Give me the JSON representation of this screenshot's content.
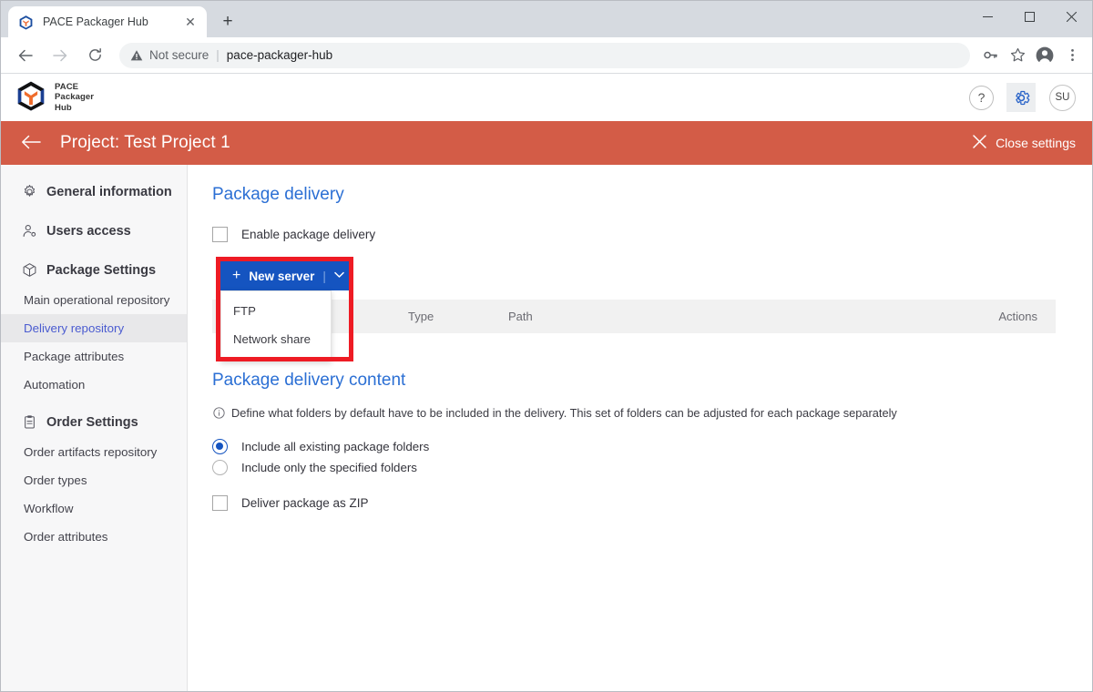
{
  "browser": {
    "tab": {
      "title": "PACE Packager Hub",
      "favicon_icon": "pace-cube-icon",
      "close_icon": "✕"
    },
    "new_tab_label": "+",
    "window_controls": {
      "minimize": "–",
      "maximize": "☐",
      "close": "✕"
    },
    "nav": {
      "back_icon": "←",
      "forward_icon": "→",
      "reload_icon": "⟳"
    },
    "omnibox": {
      "security_label": "Not secure",
      "divider": "|",
      "url": "pace-packager-hub",
      "warning_icon": "warning-triangle-icon"
    },
    "toolbar_icons": [
      "key-icon",
      "star-icon",
      "profile-avatar-icon",
      "kebab-menu-icon"
    ]
  },
  "app": {
    "brand": {
      "line1": "PACE",
      "line2": "Packager",
      "line3": "Hub",
      "logo_icon": "pace-cube-logo"
    },
    "help_label": "?",
    "settings_icon": "gear-icon",
    "avatar_initials": "SU",
    "project_bar": {
      "back_icon": "←",
      "title": "Project: Test Project 1",
      "close_icon": "✕",
      "close_label": "Close settings",
      "color": "#d35c47"
    }
  },
  "sidebar": {
    "groups": [
      {
        "label": "General information",
        "icon": "gear-icon",
        "items": []
      },
      {
        "label": "Users access",
        "icon": "user-access-icon",
        "items": []
      },
      {
        "label": "Package Settings",
        "icon": "package-cube-icon",
        "items": [
          {
            "label": "Main operational repository",
            "active": false
          },
          {
            "label": "Delivery repository",
            "active": true
          },
          {
            "label": "Package attributes",
            "active": false
          },
          {
            "label": "Automation",
            "active": false
          }
        ]
      },
      {
        "label": "Order Settings",
        "icon": "clipboard-icon",
        "items": [
          {
            "label": "Order artifacts repository",
            "active": false
          },
          {
            "label": "Order types",
            "active": false
          },
          {
            "label": "Workflow",
            "active": false
          },
          {
            "label": "Order attributes",
            "active": false
          }
        ]
      }
    ],
    "active_color": "#4a5bd0"
  },
  "content": {
    "package_delivery": {
      "title": "Package delivery",
      "enable_checkbox": {
        "label": "Enable package delivery",
        "checked": false
      },
      "new_server_button": {
        "plus": "+",
        "label": "New server",
        "divider": "|",
        "caret": "⌄",
        "color": "#1554c0"
      },
      "dropdown": {
        "open": true,
        "items": [
          {
            "label": "FTP"
          },
          {
            "label": "Network share"
          }
        ]
      },
      "table_headers": {
        "name": "",
        "type": "Type",
        "path": "Path",
        "actions": "Actions"
      }
    },
    "package_delivery_content": {
      "title": "Package delivery content",
      "info_icon": "info-circle-icon",
      "info_text": "Define what folders by default have to be included in the delivery. This set of folders can be adjusted for each package separately",
      "radios": [
        {
          "label": "Include all existing package folders",
          "selected": true
        },
        {
          "label": "Include only the specified folders",
          "selected": false
        }
      ],
      "zip_checkbox": {
        "label": "Deliver package as ZIP",
        "checked": false
      }
    }
  },
  "annotation": {
    "highlight_color": "#ee1b24",
    "shape": "rectangle"
  }
}
